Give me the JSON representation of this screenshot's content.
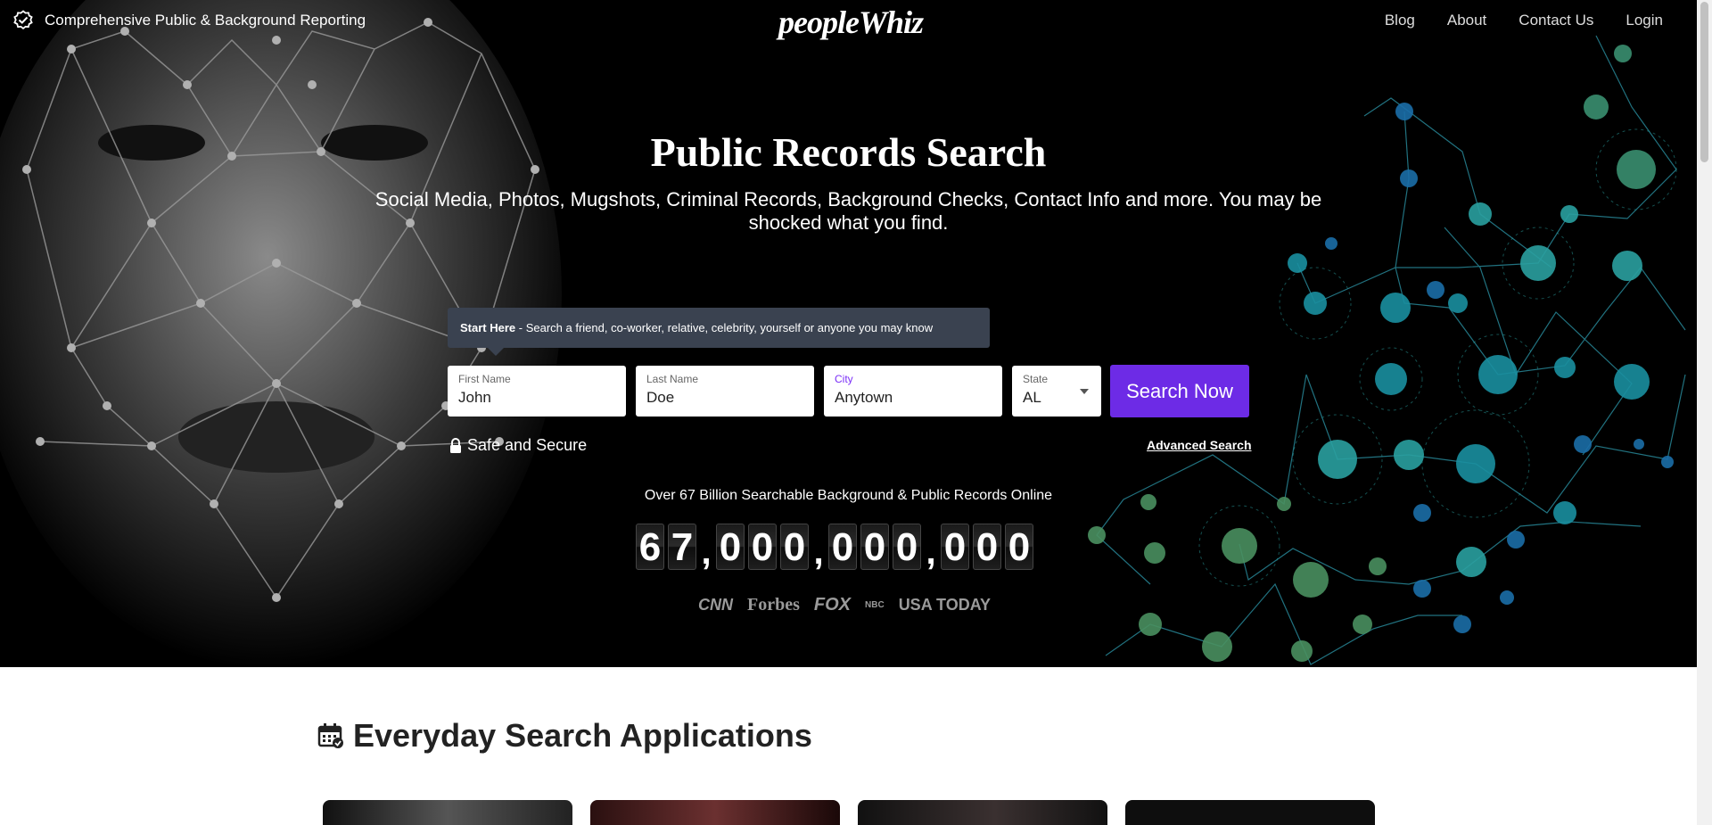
{
  "topbar": {
    "badge_text": "Comprehensive Public & Background Reporting",
    "logo": "peopleWhiz",
    "nav": [
      "Blog",
      "About",
      "Contact Us",
      "Login"
    ]
  },
  "hero": {
    "title": "Public Records Search",
    "subtitle": "Social Media, Photos, Mugshots, Criminal Records, Background Checks, Contact Info and more. You may be shocked what you find.",
    "tip_bold": "Start Here",
    "tip_text": " - Search a friend, co-worker, relative, celebrity, yourself or anyone you may know",
    "fields": {
      "first": {
        "label": "First Name",
        "value": "John"
      },
      "last": {
        "label": "Last Name",
        "value": "Doe"
      },
      "city": {
        "label": "City",
        "value": "Anytown"
      },
      "state": {
        "label": "State",
        "value": "AL"
      }
    },
    "search_button": "Search Now",
    "secure_text": "Safe and Secure",
    "advanced_text": "Advanced Search",
    "records_text": "Over 67 Billion Searchable Background & Public Records Online",
    "counter_groups": [
      "67",
      "000",
      "000",
      "000"
    ],
    "press": [
      "CNN",
      "Forbes",
      "FOX",
      "NBC",
      "USA TODAY"
    ]
  },
  "section": {
    "title": "Everyday Search Applications"
  },
  "colors": {
    "accent": "#6d2be6",
    "tooltip": "#3a4250"
  }
}
